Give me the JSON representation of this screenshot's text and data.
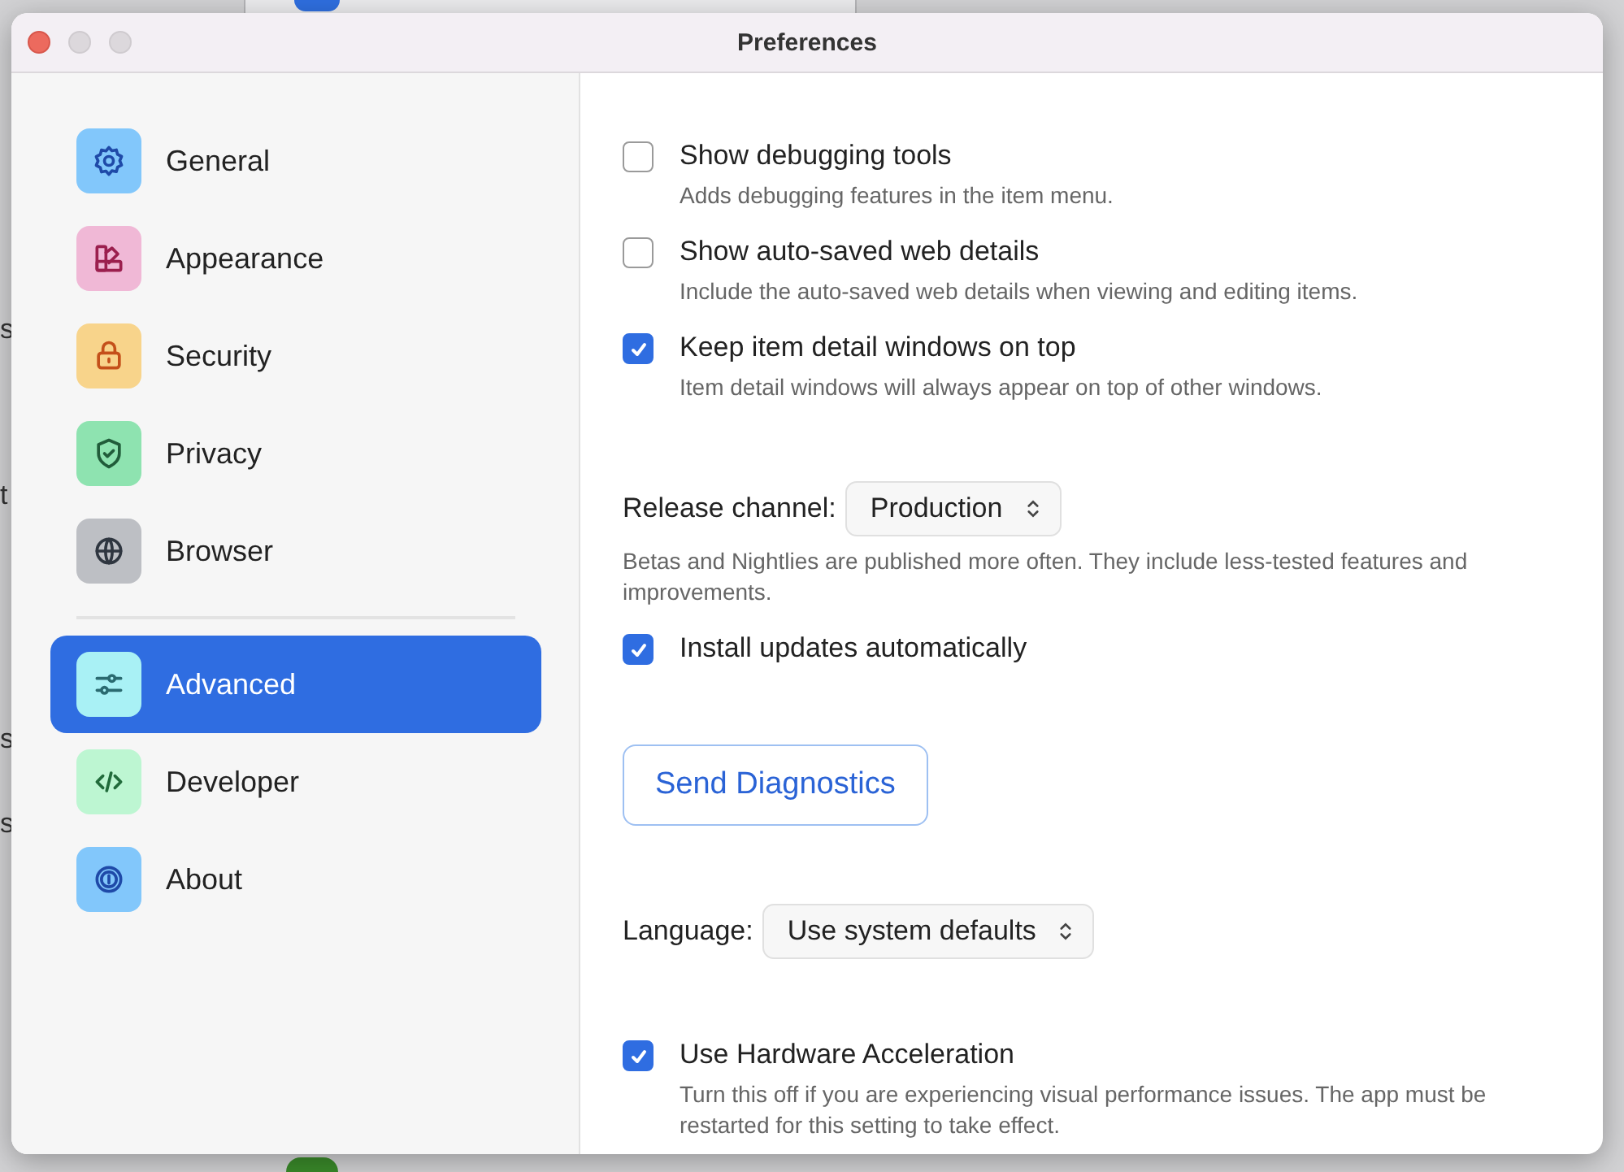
{
  "window": {
    "title": "Preferences"
  },
  "background_app": {
    "fragments": [
      {
        "text": "s"
      },
      {
        "text": "t"
      },
      {
        "text": "s"
      },
      {
        "text": "s"
      }
    ]
  },
  "sidebar": {
    "groups": [
      [
        {
          "label": "General",
          "color": "#82c7fb",
          "selected": false
        },
        {
          "label": "Appearance",
          "color": "#f0b8d6",
          "selected": false
        },
        {
          "label": "Security",
          "color": "#f8d48b",
          "selected": false
        },
        {
          "label": "Privacy",
          "color": "#8ee3b0",
          "selected": false
        },
        {
          "label": "Browser",
          "color": "#bdbfc4",
          "selected": false
        }
      ],
      [
        {
          "label": "Advanced",
          "color": "#a9f1f5",
          "selected": true
        },
        {
          "label": "Developer",
          "color": "#bdf6d2",
          "selected": false
        },
        {
          "label": "About",
          "color": "#82c7fb",
          "selected": false
        }
      ]
    ]
  },
  "settings": {
    "sections": [
      [
        {
          "kind": "checkbox",
          "label": "Show debugging tools",
          "checked": false,
          "description": "Adds debugging features in the item menu."
        },
        {
          "kind": "checkbox",
          "label": "Show auto-saved web details",
          "checked": false,
          "description": "Include the auto-saved web details when viewing and editing items."
        },
        {
          "kind": "checkbox",
          "label": "Keep item detail windows on top",
          "checked": true,
          "description": "Item detail windows will always appear on top of other windows."
        }
      ],
      [
        {
          "kind": "select",
          "label": "Release channel:",
          "value": "Production",
          "description": "Betas and Nightlies are published more often. They include less-tested features and improvements."
        },
        {
          "kind": "checkbox",
          "label": "Install updates automatically",
          "checked": true
        }
      ],
      [
        {
          "kind": "button",
          "label": "Send Diagnostics"
        }
      ],
      [
        {
          "kind": "select",
          "label": "Language:",
          "value": "Use system defaults"
        }
      ],
      [
        {
          "kind": "checkbox",
          "label": "Use Hardware Acceleration",
          "checked": true,
          "description": "Turn this off if you are experiencing visual performance issues. The app must be restarted for this setting to take effect."
        }
      ]
    ]
  }
}
